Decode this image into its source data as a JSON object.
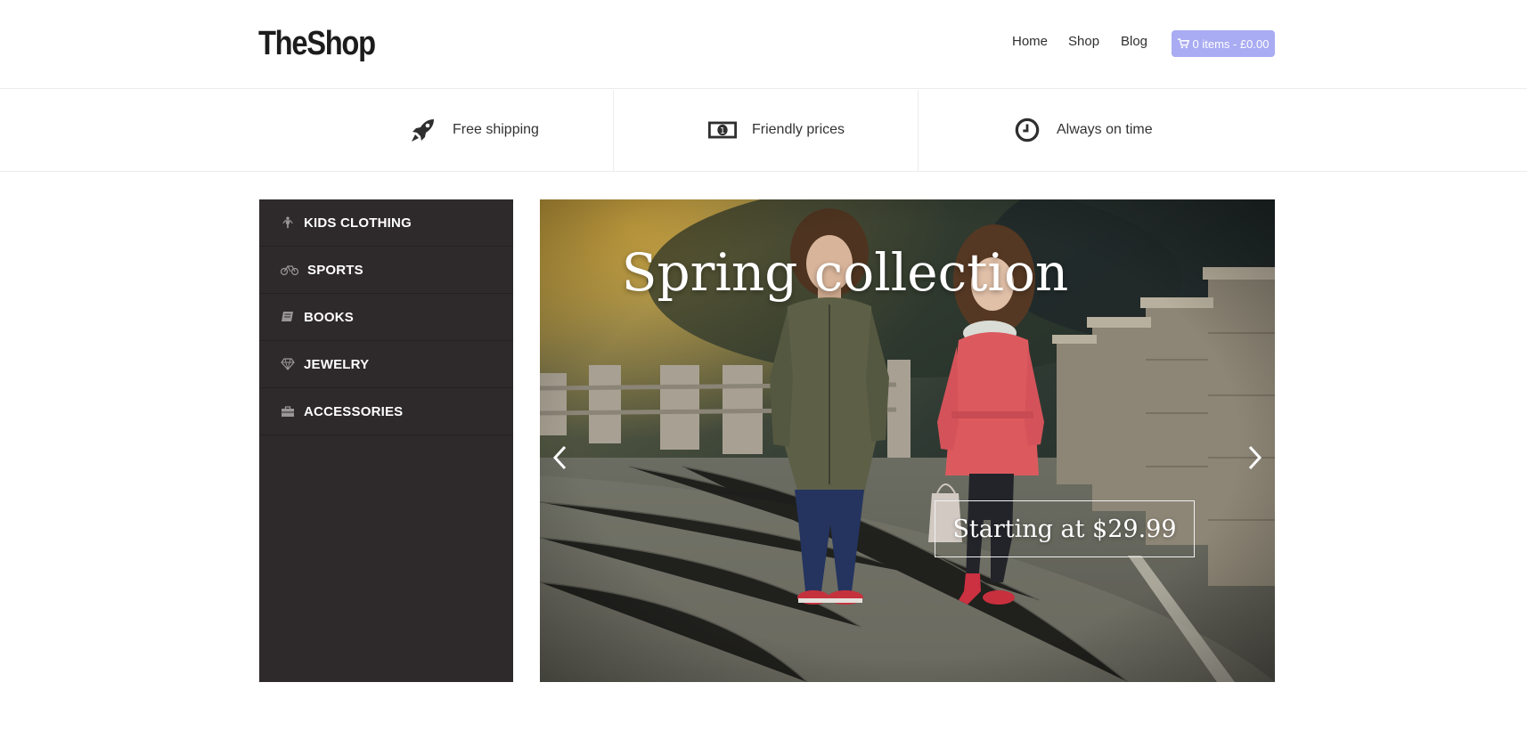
{
  "header": {
    "logo": "TheShop",
    "nav": [
      {
        "label": "Home"
      },
      {
        "label": "Shop"
      },
      {
        "label": "Blog"
      }
    ],
    "cart": {
      "label": "0 items - £0.00",
      "icon": "cart-icon",
      "color": "#a9acf2"
    }
  },
  "features": [
    {
      "label": "Free shipping",
      "icon": "rocket-icon"
    },
    {
      "label": "Friendly prices",
      "icon": "money-icon"
    },
    {
      "label": "Always on time",
      "icon": "clock-icon"
    }
  ],
  "sidebar": {
    "background": "#2e292a",
    "items": [
      {
        "label": "KIDS CLOTHING",
        "icon": "child-icon"
      },
      {
        "label": "SPORTS",
        "icon": "bicycle-icon"
      },
      {
        "label": "BOOKS",
        "icon": "book-icon"
      },
      {
        "label": "JEWELRY",
        "icon": "diamond-icon"
      },
      {
        "label": "ACCESSORIES",
        "icon": "briefcase-icon"
      }
    ]
  },
  "slider": {
    "title": "Spring collection",
    "subtitle": "Starting at $29.99",
    "prev_icon": "chevron-left-icon",
    "next_icon": "chevron-right-icon"
  }
}
